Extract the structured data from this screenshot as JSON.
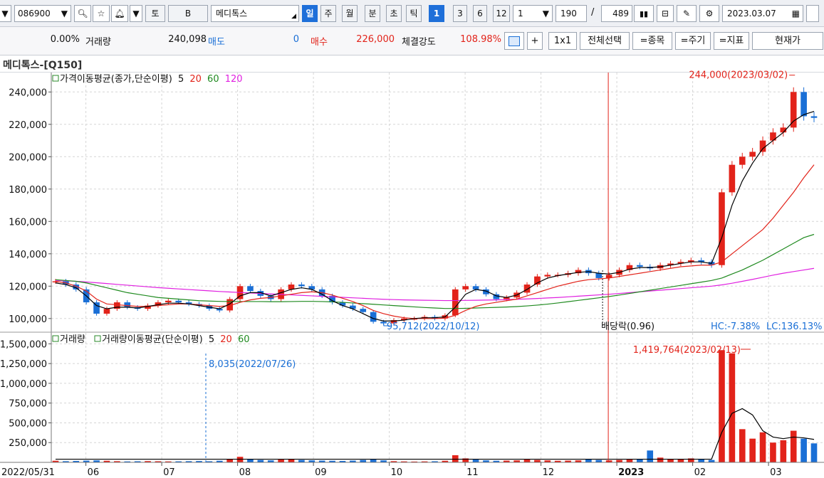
{
  "toolbar": {
    "code": "086900",
    "buttons_left": [
      "토",
      "B"
    ],
    "stock_name": "메디톡스",
    "periods": [
      "일",
      "주",
      "월",
      "분",
      "초",
      "틱"
    ],
    "num_active": "1",
    "nums": [
      "3",
      "6",
      "12"
    ],
    "interval": "1",
    "count": "190",
    "slash": "/",
    "total": "489",
    "date": "2023.03.07"
  },
  "toolbar2": {
    "change_pct": "0.00%",
    "volume_label": "거래량",
    "volume": "240,098",
    "sell_label": "매도",
    "sell": "0",
    "buy_label": "매수",
    "buy": "226,000",
    "strength_label": "체결강도",
    "strength": "108.98%",
    "plus": "+",
    "one_by_one": "1x1",
    "select_all": "전체선택",
    "btn_stock": "=종목",
    "btn_period": "=주기",
    "btn_indicator": "=지표",
    "current_price": "현재가"
  },
  "chart_title": "메디톡스-[Q150]",
  "colors": {
    "up": "#e2231a",
    "down": "#1a6fd6",
    "ma5": "#000000",
    "ma20": "#e2231a",
    "ma60": "#1f8a1f",
    "ma120": "#e020e0",
    "marker": "#e2231a",
    "annot_blue": "#1a6fd6"
  },
  "chart_data": [
    {
      "type": "candlestick",
      "legend": {
        "title": "가격이동평균(종가,단순이평)",
        "p5": "5",
        "p20": "20",
        "p60": "60",
        "p120": "120"
      },
      "y_ticks": [
        {
          "label": "100,000",
          "value": 100000
        },
        {
          "label": "120,000",
          "value": 120000
        },
        {
          "label": "140,000",
          "value": 140000
        },
        {
          "label": "160,000",
          "value": 160000
        },
        {
          "label": "180,000",
          "value": 180000
        },
        {
          "label": "200,000",
          "value": 200000
        },
        {
          "label": "220,000",
          "value": 220000
        },
        {
          "label": "240,000",
          "value": 240000
        }
      ],
      "ylim": [
        92000,
        252000
      ],
      "x_labels": [
        "2022/05/31",
        "06",
        "07",
        "08",
        "09",
        "10",
        "11",
        "12",
        "2023",
        "02",
        "03"
      ],
      "closes": [
        123000,
        121000,
        118000,
        110000,
        103000,
        106000,
        110000,
        107000,
        106000,
        108000,
        110000,
        111000,
        110000,
        109000,
        108000,
        106000,
        105000,
        112000,
        120000,
        117000,
        114000,
        112000,
        118000,
        121000,
        120000,
        118000,
        114000,
        110000,
        108000,
        106000,
        104000,
        98000,
        97000,
        99000,
        100000,
        100000,
        101000,
        100000,
        102000,
        118000,
        120000,
        118000,
        115000,
        112000,
        113000,
        116000,
        121000,
        126000,
        127000,
        127000,
        128000,
        130000,
        128000,
        125000,
        127000,
        130000,
        133000,
        132000,
        131000,
        133000,
        134000,
        135000,
        136000,
        135000,
        133000,
        178000,
        195000,
        200000,
        203000,
        210000,
        215000,
        218000,
        240000,
        225000,
        224000
      ],
      "ma5": [
        122000,
        121000,
        119000,
        114000,
        108000,
        106000,
        107000,
        107000,
        106500,
        107500,
        108500,
        109500,
        109500,
        109000,
        108000,
        107000,
        106000,
        109000,
        114000,
        116000,
        116000,
        114000,
        116000,
        118000,
        119000,
        118000,
        115000,
        111000,
        108000,
        106000,
        103000,
        100000,
        98500,
        98500,
        99000,
        100000,
        100500,
        100500,
        101000,
        107000,
        115000,
        118000,
        117000,
        114000,
        113000,
        114500,
        118000,
        122000,
        125000,
        126500,
        127500,
        128500,
        129000,
        128000,
        127500,
        128500,
        130500,
        131500,
        131500,
        132000,
        133000,
        134000,
        135000,
        135000,
        134000,
        150000,
        170000,
        185000,
        196000,
        205000,
        210000,
        215000,
        222000,
        226000,
        228000
      ],
      "ma20": [
        123000,
        122000,
        120000,
        117000,
        112000,
        109000,
        108500,
        108000,
        107500,
        107500,
        108000,
        108500,
        109000,
        109000,
        108500,
        108000,
        107500,
        108000,
        110000,
        111500,
        112500,
        113000,
        114000,
        115000,
        116000,
        116500,
        116000,
        114500,
        112500,
        110500,
        108000,
        105000,
        103000,
        101500,
        100500,
        100000,
        100000,
        100000,
        100200,
        102000,
        105000,
        107500,
        109000,
        110000,
        111000,
        112000,
        114000,
        116000,
        118000,
        120000,
        121500,
        123000,
        124000,
        124500,
        125000,
        126000,
        127000,
        128000,
        129000,
        130000,
        131000,
        132000,
        132500,
        133000,
        133000,
        135000,
        140000,
        145000,
        150000,
        155000,
        162000,
        170000,
        178000,
        187000,
        195000
      ],
      "ma60": [
        124000,
        123500,
        123000,
        122000,
        120500,
        119000,
        117500,
        116000,
        115000,
        114000,
        113000,
        112500,
        112000,
        111500,
        111000,
        110800,
        110600,
        110500,
        110500,
        110500,
        110500,
        110400,
        110400,
        110500,
        110600,
        110600,
        110500,
        110300,
        110000,
        109600,
        109200,
        108800,
        108400,
        108000,
        107600,
        107200,
        106800,
        106500,
        106200,
        106200,
        106300,
        106500,
        106700,
        106900,
        107100,
        107400,
        107800,
        108300,
        108900,
        109600,
        110400,
        111200,
        112000,
        112800,
        113600,
        114500,
        115500,
        116500,
        117500,
        118500,
        119500,
        120500,
        121500,
        122500,
        123500,
        125000,
        127500,
        130000,
        133000,
        136000,
        139500,
        143000,
        146500,
        150000,
        152000
      ],
      "ma120": [
        123500,
        123300,
        123000,
        122600,
        122100,
        121600,
        121100,
        120600,
        120100,
        119600,
        119100,
        118700,
        118300,
        117900,
        117500,
        117100,
        116700,
        116400,
        116100,
        115800,
        115500,
        115200,
        114900,
        114600,
        114300,
        114000,
        113700,
        113400,
        113100,
        112800,
        112500,
        112200,
        111900,
        111700,
        111500,
        111400,
        111300,
        111200,
        111100,
        111100,
        111200,
        111300,
        111400,
        111500,
        111700,
        111900,
        112100,
        112400,
        112700,
        113000,
        113400,
        113800,
        114200,
        114600,
        115000,
        115500,
        116000,
        116500,
        117000,
        117500,
        118000,
        118500,
        119000,
        119500,
        120000,
        120800,
        121800,
        123000,
        124200,
        125500,
        126800,
        128000,
        129000,
        130000,
        131000
      ],
      "high_annotation": "244,000(2023/03/02)",
      "low_annotation": "95,712(2022/10/12)",
      "dividend_label": "배당락(0.96)",
      "hc_label": "HC:-7.38%",
      "lc_label": "LC:136.13%"
    },
    {
      "type": "bar",
      "legend": {
        "title1": "거래량",
        "title2": "거래량이동평균(단순이평)",
        "p5": "5",
        "p20": "20",
        "p60": "60"
      },
      "y_ticks": [
        {
          "label": "250,000",
          "value": 250000
        },
        {
          "label": "500,000",
          "value": 500000
        },
        {
          "label": "750,000",
          "value": 750000
        },
        {
          "label": "1,000,000",
          "value": 1000000
        },
        {
          "label": "1,250,000",
          "value": 1250000
        },
        {
          "label": "1,500,000",
          "value": 1500000
        }
      ],
      "ylim": [
        0,
        1620000
      ],
      "volumes": [
        20000,
        15000,
        18000,
        22000,
        25000,
        20000,
        15000,
        12000,
        14000,
        16000,
        14000,
        12000,
        13000,
        15000,
        17000,
        14000,
        20000,
        40000,
        70000,
        45000,
        30000,
        25000,
        35000,
        40000,
        30000,
        25000,
        22000,
        20000,
        18000,
        22000,
        30000,
        35000,
        25000,
        15000,
        12000,
        10000,
        12000,
        14000,
        20000,
        90000,
        50000,
        35000,
        25000,
        20000,
        22000,
        25000,
        35000,
        30000,
        25000,
        20000,
        22000,
        25000,
        40000,
        30000,
        25000,
        30000,
        35000,
        40000,
        150000,
        60000,
        40000,
        45000,
        50000,
        40000,
        30000,
        1419764,
        1380000,
        420000,
        300000,
        380000,
        250000,
        280000,
        400000,
        300000,
        240098
      ],
      "vma5_overlay": [
        40000,
        40000,
        40000,
        40000,
        40000,
        40000,
        40000,
        40000,
        40000,
        40000,
        40000,
        40000,
        40000,
        40000,
        40000,
        40000,
        40000,
        40000,
        40000,
        40000,
        40000,
        40000,
        40000,
        40000,
        40000,
        40000,
        40000,
        40000,
        40000,
        40000,
        40000,
        40000,
        40000,
        40000,
        40000,
        40000,
        40000,
        40000,
        40000,
        40000,
        40000,
        40000,
        40000,
        40000,
        40000,
        40000,
        40000,
        40000,
        40000,
        40000,
        40000,
        40000,
        40000,
        40000,
        40000,
        40000,
        40000,
        40000,
        40000,
        40000,
        40000,
        40000,
        40000,
        40000,
        40000,
        380000,
        620000,
        680000,
        600000,
        400000,
        320000,
        300000,
        320000,
        310000,
        290000
      ],
      "max_annotation": "1,419,764(2023/02/13)",
      "min_annotation": "8,035(2022/07/26)"
    }
  ]
}
